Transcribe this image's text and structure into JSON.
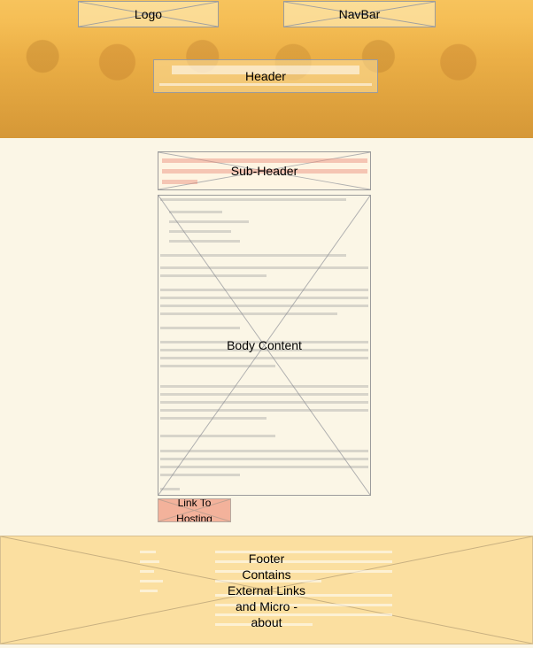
{
  "wireframe": {
    "logo_label": "Logo",
    "navbar_label": "NavBar",
    "header_label": "Header",
    "subheader_label": "Sub-Header",
    "body_label": "Body Content",
    "link_label": "Link To Hosting",
    "footer_lines": [
      "Footer",
      "Contains",
      "External Links",
      "and Micro -",
      "about"
    ]
  },
  "colors": {
    "hero": "#f2b64a",
    "page_bg": "#fbf6e6",
    "link_bg": "#f3b29b",
    "footer_bg": "#fbdfa0"
  }
}
